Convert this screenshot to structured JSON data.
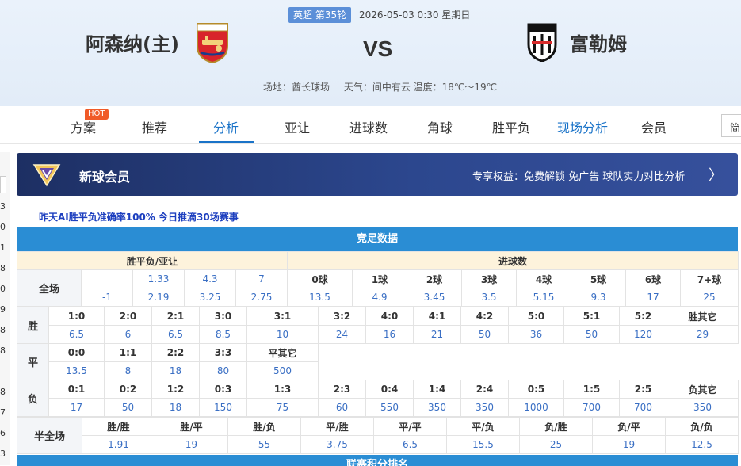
{
  "match": {
    "round": "英超 第35轮",
    "time": "2026-05-03 0:30 星期日",
    "home": "阿森纳(主)",
    "away": "富勒姆",
    "vs": "VS",
    "venue": "场地：酋长球场",
    "weather": "天气：间中有云 温度：18℃～19℃"
  },
  "tabs": [
    {
      "label": "方案",
      "badge": "HOT"
    },
    {
      "label": "推荐"
    },
    {
      "label": "分析"
    },
    {
      "label": "亚让"
    },
    {
      "label": "进球数"
    },
    {
      "label": "角球"
    },
    {
      "label": "胜平负"
    },
    {
      "label": "现场分析"
    },
    {
      "label": "会员"
    }
  ],
  "simple_label": "简",
  "left_strip": [
    "3",
    "0",
    "1",
    "8",
    "0",
    "9",
    "8",
    "8",
    "8",
    "7",
    "6",
    "3"
  ],
  "banner": {
    "title": "新球会员",
    "benefit": "专享权益：免费解锁 免广告 球队实力对比分析",
    "arrow": "〉"
  },
  "promo": "昨天AI胜平负准确率100% 今日推滴30场赛事",
  "odds": {
    "title": "竞足数据",
    "hdr_1x2": "胜平负/亚让",
    "hdr_goals": "进球数",
    "label_full": "全场",
    "full_row1": [
      "",
      "1.33",
      "4.3",
      "7"
    ],
    "full_row2": [
      "-1",
      "2.19",
      "3.25",
      "2.75"
    ],
    "goal_labels": [
      "0球",
      "1球",
      "2球",
      "3球",
      "4球",
      "5球",
      "6球",
      "7+球"
    ],
    "goal_values": [
      "13.5",
      "4.9",
      "3.45",
      "3.5",
      "5.15",
      "9.3",
      "17",
      "25"
    ],
    "win_label": "胜",
    "win_scores": [
      "1:0",
      "2:0",
      "2:1",
      "3:0",
      "3:1",
      "3:2",
      "4:0",
      "4:1",
      "4:2",
      "5:0",
      "5:1",
      "5:2",
      "胜其它"
    ],
    "win_values": [
      "6.5",
      "6",
      "6.5",
      "8.5",
      "10",
      "24",
      "16",
      "21",
      "50",
      "36",
      "50",
      "120",
      "29"
    ],
    "draw_label": "平",
    "draw_scores": [
      "0:0",
      "1:1",
      "2:2",
      "3:3",
      "平其它"
    ],
    "draw_values": [
      "13.5",
      "8",
      "18",
      "80",
      "500"
    ],
    "loss_label": "负",
    "loss_scores": [
      "0:1",
      "0:2",
      "1:2",
      "0:3",
      "1:3",
      "2:3",
      "0:4",
      "1:4",
      "2:4",
      "0:5",
      "1:5",
      "2:5",
      "负其它"
    ],
    "loss_values": [
      "17",
      "50",
      "18",
      "150",
      "75",
      "60",
      "550",
      "350",
      "350",
      "1000",
      "700",
      "700",
      "350"
    ],
    "ht_label": "半全场",
    "ht_results": [
      "胜/胜",
      "胜/平",
      "胜/负",
      "平/胜",
      "平/平",
      "平/负",
      "负/胜",
      "负/平",
      "负/负"
    ],
    "ht_values": [
      "1.91",
      "19",
      "55",
      "3.75",
      "6.5",
      "15.5",
      "25",
      "19",
      "12.5"
    ]
  },
  "bottom_bar": "联赛积分排名"
}
